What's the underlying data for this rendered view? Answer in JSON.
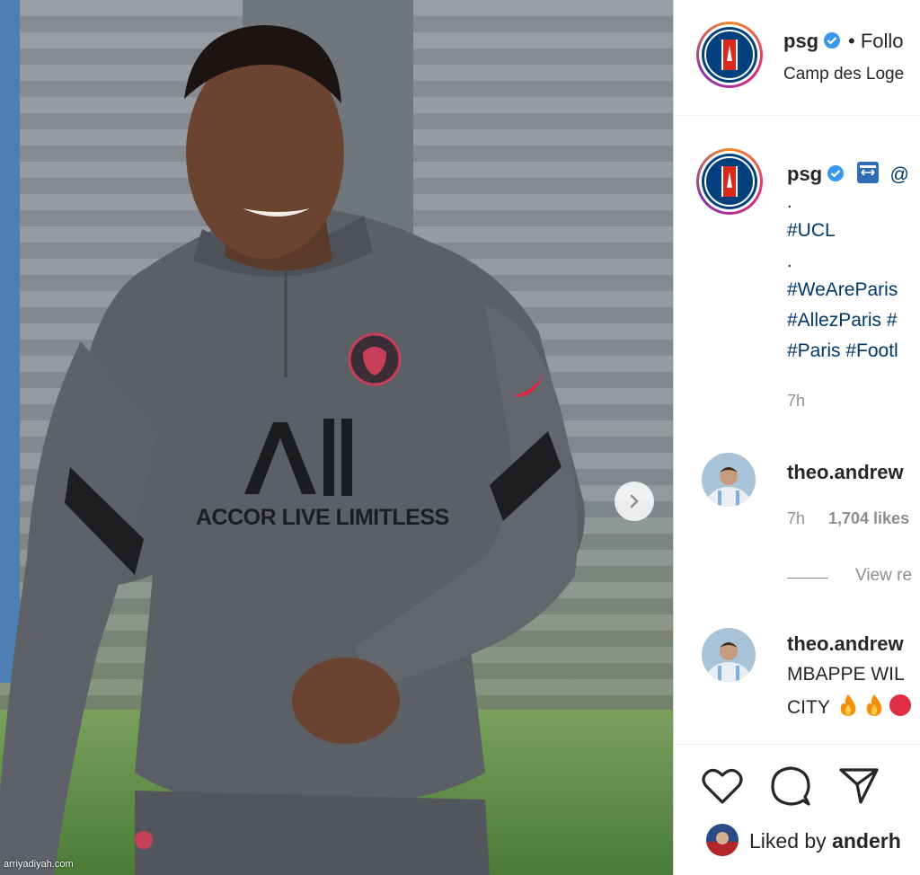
{
  "post": {
    "username": "psg",
    "follow_label": "• Follo",
    "location": "Camp des Loge",
    "jersey_text": "ACCOR LIVE LIMITLESS",
    "jersey_brand": "All"
  },
  "caption": {
    "username": "psg",
    "mention": "@",
    "dot1": ".",
    "tag1": "#UCL",
    "dot2": ".",
    "line1": "#WeAreParis",
    "line2": "#AllezParis #",
    "line3": "#Paris #Footl",
    "time": "7h"
  },
  "comments": [
    {
      "username": "theo.andrew",
      "time": "7h",
      "likes": "1,704 likes",
      "view_replies": "View re"
    },
    {
      "username": "theo.andrew",
      "text_line1": "MBAPPE WIL",
      "text_line2": "CITY"
    }
  ],
  "actions": {
    "liked_by_prefix": "Liked by ",
    "liked_by_user": "anderh"
  },
  "watermark": "arriyadiyah.com",
  "colors": {
    "accent": "#0095f6",
    "hashtag": "#00376b",
    "psg_navy": "#00417d",
    "psg_red": "#da291c"
  }
}
